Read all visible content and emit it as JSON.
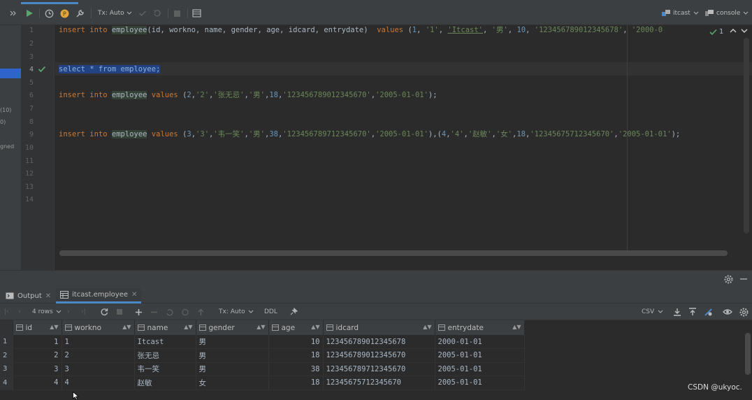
{
  "toolbar": {
    "tx_label": "Tx: Auto",
    "datasource": "itcast",
    "console": "console"
  },
  "left_fragments": [
    "(10)",
    "0)",
    "gned"
  ],
  "editor": {
    "line_numbers": [
      "1",
      "2",
      "3",
      "4",
      "5",
      "6",
      "7",
      "8",
      "9",
      "10",
      "11",
      "12",
      "13",
      "14"
    ],
    "current_line": "4",
    "inspection_count": "1",
    "lines": {
      "l1": [
        "insert",
        "into",
        "employee",
        "(id, workno, name, gender, age, idcard, entrydate)",
        "values",
        "(",
        "1",
        ", ",
        "'1'",
        ", ",
        "'Itcast'",
        ", ",
        "'男'",
        ", ",
        "10",
        ", ",
        "'123456789012345678'",
        ", ",
        "'2000-0"
      ],
      "l4": "select * from employee;",
      "l6": [
        "insert",
        "into",
        "employee",
        "values",
        "(",
        "2",
        ",",
        "'2'",
        ",",
        "'张无忌'",
        ",",
        "'男'",
        ",",
        "18",
        ",",
        "'123456789012345670'",
        ",",
        "'2005-01-01'",
        ");"
      ],
      "l9": [
        "insert",
        "into",
        "employee",
        "values",
        "(",
        "3",
        ",",
        "'3'",
        ",",
        "'韦一笑'",
        ",",
        "'男'",
        ",",
        "38",
        ",",
        "'123456789712345670'",
        ",",
        "'2005-01-01'",
        "),(",
        "4",
        ",",
        "'4'",
        ",",
        "'赵敏'",
        ",",
        "'女'",
        ",",
        "18",
        ",",
        "'123456757123456​70'",
        ",",
        "'2005-01-01'",
        ");"
      ]
    }
  },
  "bottom_tabs": [
    {
      "label": "Output"
    },
    {
      "label": "itcast.employee"
    }
  ],
  "grid_toolbar": {
    "rows": "4 rows",
    "tx": "Tx: Auto",
    "ddl": "DDL",
    "csv": "CSV"
  },
  "result": {
    "columns": [
      "id",
      "workno",
      "name",
      "gender",
      "age",
      "idcard",
      "entrydate"
    ],
    "rows": [
      {
        "n": "1",
        "id": "1",
        "workno": "1",
        "name": "Itcast",
        "gender": "男",
        "age": "10",
        "idcard": "123456789012345678",
        "entrydate": "2000-01-01"
      },
      {
        "n": "2",
        "id": "2",
        "workno": "2",
        "name": "张无忌",
        "gender": "男",
        "age": "18",
        "idcard": "123456789012345670",
        "entrydate": "2005-01-01"
      },
      {
        "n": "3",
        "id": "3",
        "workno": "3",
        "name": "韦一笑",
        "gender": "男",
        "age": "38",
        "idcard": "123456789712345670",
        "entrydate": "2005-01-01"
      },
      {
        "n": "4",
        "id": "4",
        "workno": "4",
        "name": "赵敏",
        "gender": "女",
        "age": "18",
        "idcard": "123456757123456​70",
        "entrydate": "2005-01-01"
      }
    ]
  },
  "watermark": "CSDN @ukyoc."
}
